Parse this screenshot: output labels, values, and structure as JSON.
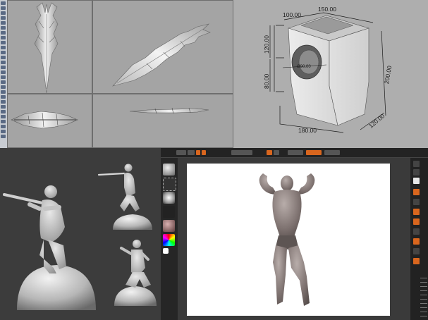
{
  "rhino": {
    "viewport_labels": [
      "",
      "",
      "",
      ""
    ]
  },
  "dimensions": {
    "top_width": "150.00",
    "top_depth": "100.00",
    "upper_height": "120.00",
    "lower_height": "80.00",
    "total_height": "200.00",
    "base_width": "180.00",
    "base_depth": "120.00",
    "opening_label": "Ø90.00"
  },
  "zbrush": {
    "title": "",
    "colors": {
      "accent": "#d9661e",
      "background": "#2c2c2c",
      "document": "#ffffff"
    }
  }
}
